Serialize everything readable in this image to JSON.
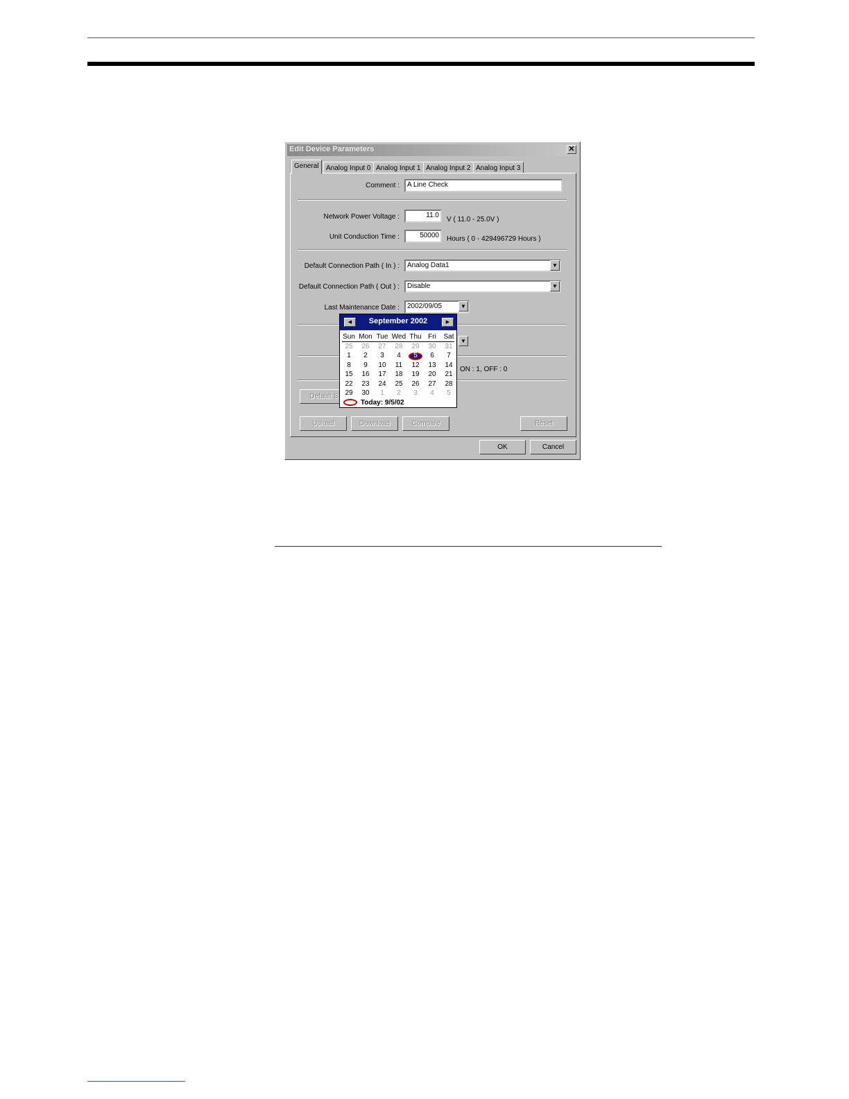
{
  "dialog": {
    "title": "Edit Device Parameters",
    "close_glyph": "✕",
    "tabs": [
      "General",
      "Analog Input 0",
      "Analog Input 1",
      "Analog Input 2",
      "Analog Input 3"
    ],
    "active_tab": "General",
    "comment": {
      "label": "Comment :",
      "value": "A Line Check"
    },
    "network_power_voltage": {
      "label": "Network Power Voltage :",
      "value": "11.0",
      "range": "V ( 11.0 - 25.0V )"
    },
    "unit_conduction_time": {
      "label": "Unit Conduction Time :",
      "value": "50000",
      "range": "Hours ( 0 - 429496729 Hours )"
    },
    "default_path_in": {
      "label": "Default Connection Path ( In ) :",
      "value": "Analog Data1"
    },
    "default_path_out": {
      "label": "Default Connection Path ( Out ) :",
      "value": "Disable"
    },
    "last_maintenance_date": {
      "label": "Last Maintenance Date :",
      "value": "2002/09/05"
    },
    "onoff_text": "ON : 1, OFF : 0",
    "buttons": {
      "default_setting": "Default S",
      "upload": "Upload",
      "download": "Download",
      "compare": "Compare",
      "reset": "Reset",
      "ok": "OK",
      "cancel": "Cancel"
    }
  },
  "calendar": {
    "month_label": "September 2002",
    "prev_glyph": "◀",
    "next_glyph": "▶",
    "weekdays": [
      "Sun",
      "Mon",
      "Tue",
      "Wed",
      "Thu",
      "Fri",
      "Sat"
    ],
    "weeks": [
      [
        "25",
        "26",
        "27",
        "28",
        "29",
        "30",
        "31"
      ],
      [
        "1",
        "2",
        "3",
        "4",
        "5",
        "6",
        "7"
      ],
      [
        "8",
        "9",
        "10",
        "11",
        "12",
        "13",
        "14"
      ],
      [
        "15",
        "16",
        "17",
        "18",
        "19",
        "20",
        "21"
      ],
      [
        "22",
        "23",
        "24",
        "25",
        "26",
        "27",
        "28"
      ],
      [
        "29",
        "30",
        "1",
        "2",
        "3",
        "4",
        "5"
      ]
    ],
    "selected_day": "5",
    "today_label": "Today: 9/5/02"
  },
  "dropdown_glyph": "▼"
}
